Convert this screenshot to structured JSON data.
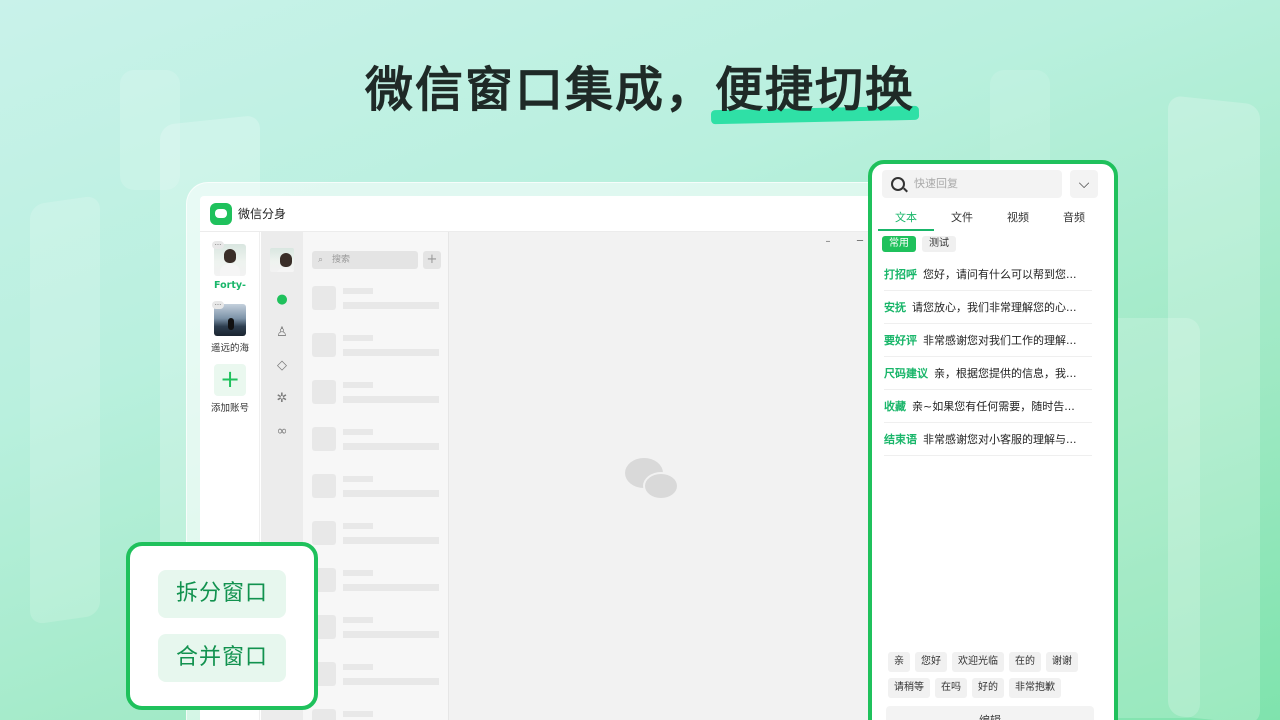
{
  "headline": {
    "part1": "微信窗口集成，",
    "part2": "便捷切换"
  },
  "app": {
    "title": "微信分身",
    "accounts": [
      {
        "label": "Forty-",
        "more": "···",
        "active": true
      },
      {
        "label": "遥远的海",
        "more": "···",
        "active": false
      }
    ],
    "add_account_label": "添加账号",
    "search_placeholder": "搜索",
    "add_symbol": "+",
    "window_controls": {
      "menu": "–",
      "minimize": "─",
      "maximize": "☐",
      "close": "✕"
    }
  },
  "side_panel": {
    "split_label": "拆分窗口",
    "merge_label": "合并窗口"
  },
  "quick_reply": {
    "search_placeholder": "快速回复",
    "tabs": [
      "文本",
      "文件",
      "视频",
      "音频"
    ],
    "sub_tabs": [
      "常用",
      "测试"
    ],
    "items": [
      {
        "key": "打招呼",
        "text": "您好，请问有什么可以帮到您..."
      },
      {
        "key": "安抚",
        "text": "请您放心，我们非常理解您的心..."
      },
      {
        "key": "要好评",
        "text": "非常感谢您对我们工作的理解..."
      },
      {
        "key": "尺码建议",
        "text": "亲，根据您提供的信息，我..."
      },
      {
        "key": "收藏",
        "text": "亲~如果您有任何需要，随时告..."
      },
      {
        "key": "结束语",
        "text": "非常感谢您对小客服的理解与..."
      }
    ],
    "tags": [
      "亲",
      "您好",
      "欢迎光临",
      "在的",
      "谢谢",
      "请稍等",
      "在吗",
      "好的",
      "非常抱歉"
    ],
    "bottom_label": "编辑"
  },
  "colors": {
    "brand": "#1fc15c",
    "accent_text": "#19b66a",
    "highlight": "#2fe0a6"
  }
}
